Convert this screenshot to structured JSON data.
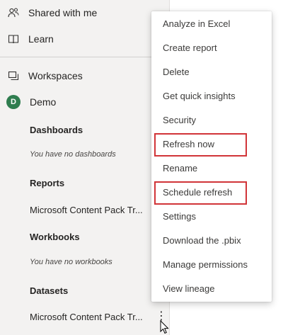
{
  "nav": {
    "shared_label": "Shared with me",
    "shared_icon": "shared-people-icon",
    "learn_label": "Learn",
    "learn_icon": "book-icon",
    "workspaces_label": "Workspaces",
    "workspaces_icon": "workspaces-icon",
    "demo_label": "Demo",
    "demo_avatar_text": "D"
  },
  "workspace": {
    "dashboards_header": "Dashboards",
    "dashboards_empty": "You have no dashboards",
    "reports_header": "Reports",
    "reports_item": "Microsoft Content Pack Tr...",
    "workbooks_header": "Workbooks",
    "workbooks_empty": "You have no workbooks",
    "datasets_header": "Datasets",
    "datasets_item": "Microsoft Content Pack Tr...",
    "more_options_symbol": "⋮"
  },
  "context_menu": {
    "items": [
      "Analyze in Excel",
      "Create report",
      "Delete",
      "Get quick insights",
      "Security",
      "Refresh now",
      "Rename",
      "Schedule refresh",
      "Settings",
      "Download the .pbix",
      "Manage permissions",
      "View lineage"
    ],
    "highlighted": [
      "Refresh now",
      "Schedule refresh"
    ],
    "highlight_color": "#d13438"
  },
  "colors": {
    "nav_background": "#f3f2f1",
    "avatar_green": "#2f7d4f"
  }
}
